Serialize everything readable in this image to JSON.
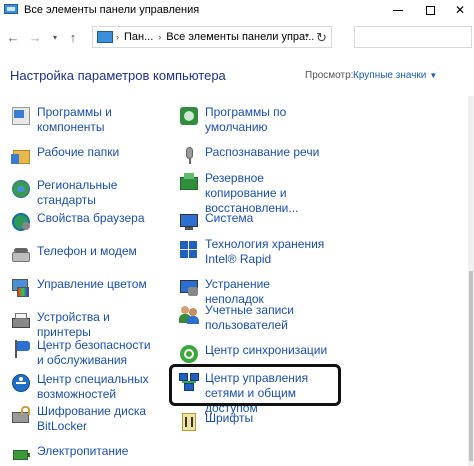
{
  "window": {
    "title": "Все элементы панели управления",
    "close_glyph": "✕"
  },
  "address": {
    "crumb1": "Пан...",
    "crumb2": "Все элементы панели упра...",
    "back_glyph": "←",
    "forward_glyph": "→",
    "up_glyph": "↑",
    "history_glyph": "▾",
    "dropdown_glyph": "▾",
    "refresh_glyph": "↻",
    "separator_glyph": "›"
  },
  "header": {
    "title": "Настройка параметров компьютера",
    "view_label": "Просмотр:",
    "view_value": "Крупные значки",
    "view_caret": "▼"
  },
  "items_left": [
    {
      "label": "Программы и компоненты",
      "icon": "programs-icon"
    },
    {
      "label": "Рабочие папки",
      "icon": "work-folders-icon"
    },
    {
      "label": "Региональные стандарты",
      "icon": "region-icon"
    },
    {
      "label": "Свойства браузера",
      "icon": "internet-options-icon"
    },
    {
      "label": "Телефон и модем",
      "icon": "phone-modem-icon"
    },
    {
      "label": "Управление цветом",
      "icon": "color-management-icon"
    },
    {
      "label": "Устройства и принтеры",
      "icon": "devices-printers-icon"
    },
    {
      "label": "Центр безопасности и обслуживания",
      "icon": "security-flag-icon"
    },
    {
      "label": "Центр специальных возможностей",
      "icon": "ease-of-access-icon"
    },
    {
      "label": "Шифрование диска BitLocker",
      "icon": "bitlocker-icon"
    },
    {
      "label": "Электропитание",
      "icon": "power-options-icon"
    }
  ],
  "items_right": [
    {
      "label": "Программы по умолчанию",
      "icon": "default-programs-icon"
    },
    {
      "label": "Распознавание речи",
      "icon": "microphone-icon"
    },
    {
      "label": "Резервное копирование и восстановлени...",
      "icon": "backup-restore-icon"
    },
    {
      "label": "Система",
      "icon": "system-icon"
    },
    {
      "label": "Технология хранения Intel® Rapid",
      "icon": "intel-rapid-icon"
    },
    {
      "label": "Устранение неполадок",
      "icon": "troubleshooting-icon"
    },
    {
      "label": "Учетные записи пользователей",
      "icon": "user-accounts-icon"
    },
    {
      "label": "Центр синхронизации",
      "icon": "sync-center-icon"
    },
    {
      "label": "Центр управления сетями и общим доступом",
      "icon": "network-sharing-icon"
    },
    {
      "label": "Шрифты",
      "icon": "fonts-icon"
    }
  ],
  "colors": {
    "link": "#1a4fb3",
    "title": "#1e3287",
    "highlight": "#111111"
  }
}
